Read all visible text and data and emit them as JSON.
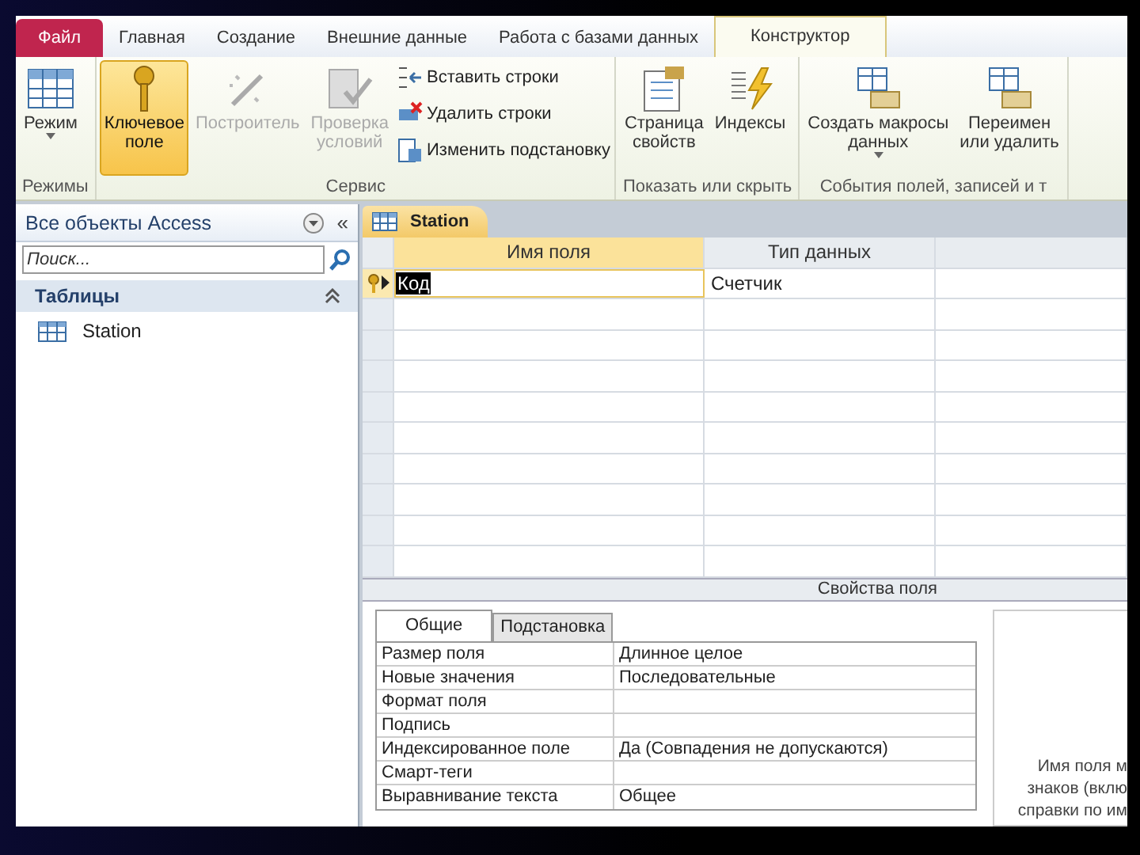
{
  "ribbon_tabs": [
    {
      "label": "Файл",
      "kind": "file",
      "selected": false
    },
    {
      "label": "Главная",
      "kind": "tab",
      "selected": false
    },
    {
      "label": "Создание",
      "kind": "tab",
      "selected": false
    },
    {
      "label": "Внешние данные",
      "kind": "tab",
      "selected": false
    },
    {
      "label": "Работа с базами данных",
      "kind": "tab",
      "selected": false
    },
    {
      "label": "Конструктор",
      "kind": "tab",
      "selected": true
    }
  ],
  "ribbon_groups": [
    {
      "label": "Режимы",
      "items": [
        {
          "kind": "large",
          "label": "Режим",
          "dropdown": true,
          "on": false,
          "disabled": false
        }
      ]
    },
    {
      "label": "Сервис",
      "items": [
        {
          "kind": "large",
          "label": "Ключевое\nполе",
          "on": true,
          "disabled": false
        },
        {
          "kind": "large",
          "label": "Построитель",
          "on": false,
          "disabled": true
        },
        {
          "kind": "large",
          "label": "Проверка\nусловий",
          "on": false,
          "disabled": true
        },
        {
          "kind": "small",
          "label": "Вставить строки",
          "on": false,
          "disabled": false
        },
        {
          "kind": "small",
          "label": "Удалить строки",
          "on": false,
          "disabled": false
        },
        {
          "kind": "small",
          "label": "Изменить подстановку",
          "on": false,
          "disabled": false
        }
      ]
    },
    {
      "label": "Показать или скрыть",
      "items": [
        {
          "kind": "large",
          "label": "Страница\nсвойств",
          "on": false,
          "disabled": false
        },
        {
          "kind": "large",
          "label": "Индексы",
          "on": false,
          "disabled": false
        }
      ]
    },
    {
      "label": "События полей, записей и т",
      "items": [
        {
          "kind": "large",
          "label": "Создать макросы\nданных",
          "dropdown": true,
          "on": false,
          "disabled": false
        },
        {
          "kind": "large",
          "label": "Переимен\nили удалить",
          "on": false,
          "disabled": false
        }
      ]
    }
  ],
  "nav_pane": {
    "title": "Все объекты Access",
    "collapse": "«",
    "search": {
      "placeholder": "Поиск..."
    },
    "groups": [
      {
        "label": "Таблицы",
        "expanded": true,
        "items": [
          {
            "label": "Station"
          }
        ]
      }
    ]
  },
  "document_tab": {
    "label": "Station"
  },
  "design_grid": {
    "columns": [
      "Имя поля",
      "Тип данных"
    ],
    "rows": [
      {
        "field_name": "Код",
        "data_type": "Счетчик",
        "primary_key": true,
        "current": true
      }
    ]
  },
  "field_properties": {
    "title": "Свойства поля",
    "tabs": [
      {
        "label": "Общие",
        "selected": true
      },
      {
        "label": "Подстановка",
        "selected": false
      }
    ],
    "rows": [
      {
        "name": "Размер поля",
        "value": "Длинное целое"
      },
      {
        "name": "Новые значения",
        "value": "Последовательные"
      },
      {
        "name": "Формат поля"
      },
      {
        "name": "Подпись"
      },
      {
        "name": "Индексированное поле",
        "value": "Да (Совпадения не допускаются)"
      },
      {
        "name": "Смарт-теги"
      },
      {
        "name": "Выравнивание текста",
        "value": "Общее"
      }
    ],
    "help_lines": [
      "Имя поля м",
      "знаков (вклю",
      "справки по им"
    ]
  }
}
